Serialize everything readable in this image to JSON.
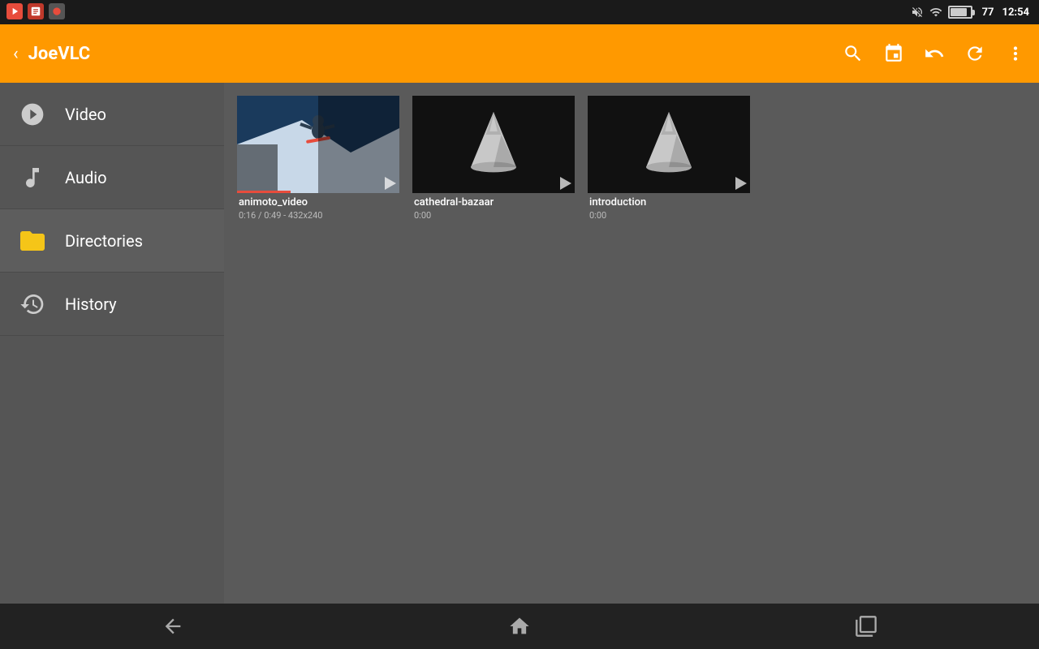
{
  "statusBar": {
    "time": "12:54",
    "battery": "77",
    "icons": [
      "mute",
      "wifi",
      "battery"
    ]
  },
  "appBar": {
    "title": "JoeVLC",
    "backLabel": "‹",
    "actions": {
      "search": "search",
      "pin": "pin",
      "back": "back",
      "refresh": "refresh",
      "more": "more"
    }
  },
  "sidebar": {
    "items": [
      {
        "id": "video",
        "label": "Video",
        "icon": "🎬"
      },
      {
        "id": "audio",
        "label": "Audio",
        "icon": "♪"
      },
      {
        "id": "directories",
        "label": "Directories",
        "icon": "📁"
      },
      {
        "id": "history",
        "label": "History",
        "icon": "🕐"
      }
    ]
  },
  "videos": [
    {
      "id": "animoto",
      "title": "animoto_video",
      "meta": "0:16 / 0:49 - 432x240",
      "type": "snowboard",
      "hasProgress": true
    },
    {
      "id": "cathedral",
      "title": "cathedral-bazaar",
      "meta": "0:00",
      "type": "vlc",
      "hasProgress": false
    },
    {
      "id": "introduction",
      "title": "introduction",
      "meta": "0:00",
      "type": "vlc",
      "hasProgress": false
    }
  ],
  "bottomNav": {
    "back": "←",
    "home": "⌂",
    "recents": "▭"
  }
}
